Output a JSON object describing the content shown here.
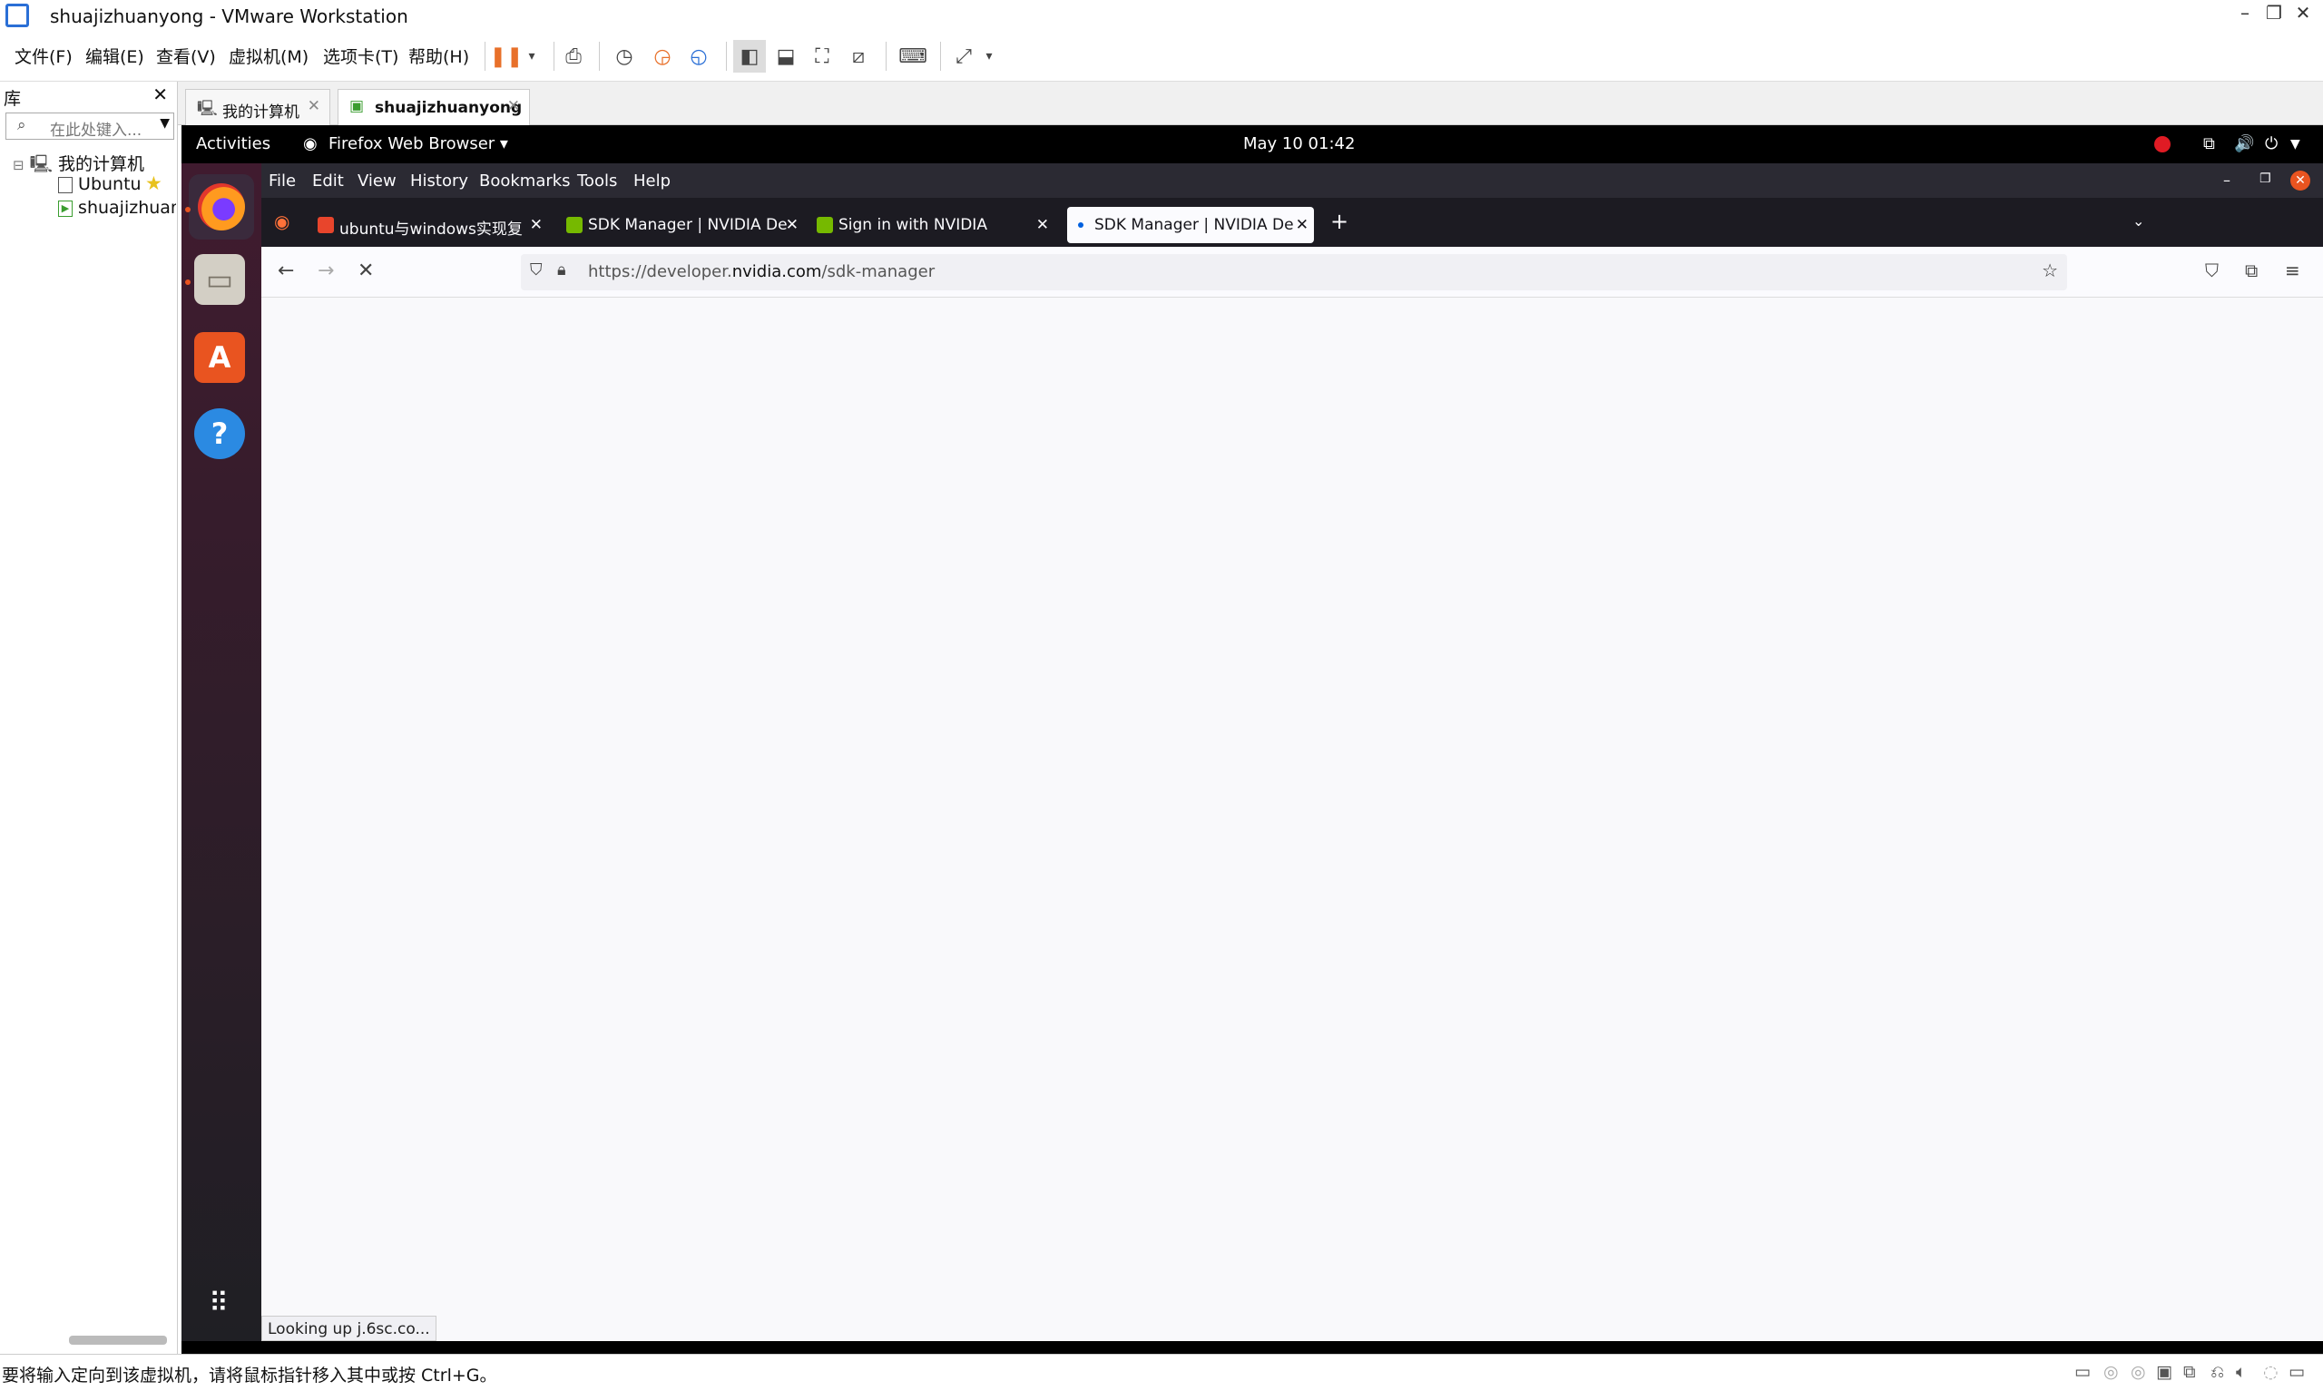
{
  "window": {
    "title": "shuajizhuanyong - VMware Workstation",
    "minimize": "–",
    "restore": "❐",
    "close": "✕"
  },
  "menubar": {
    "items": [
      "文件(F)",
      "编辑(E)",
      "查看(V)",
      "虚拟机(M)",
      "选项卡(T)",
      "帮助(H)"
    ]
  },
  "library": {
    "header": "库",
    "close": "✕",
    "search_placeholder": "在此处键入...",
    "tree": {
      "root": "我的计算机",
      "expander": "⊟",
      "children": [
        "Ubuntu",
        "shuajizhuanyong"
      ]
    }
  },
  "vm_tabs": [
    {
      "label": "我的计算机",
      "close": "✕"
    },
    {
      "label": "shuajizhuanyong",
      "close": "✕"
    }
  ],
  "gnome": {
    "activities": "Activities",
    "app": "Firefox Web Browser ▾",
    "clock": "May 10  01:42"
  },
  "firefox": {
    "menu": [
      "File",
      "Edit",
      "View",
      "History",
      "Bookmarks",
      "Tools",
      "Help"
    ],
    "tabs": [
      {
        "title": "ubuntu与windows实现复",
        "close": "✕",
        "color": "#e8452c"
      },
      {
        "title": "SDK Manager | NVIDIA De",
        "close": "✕",
        "color": "#76b900"
      },
      {
        "title": "Sign in with NVIDIA",
        "close": "✕",
        "color": "#76b900"
      },
      {
        "title": "SDK Manager | NVIDIA De",
        "close": "✕",
        "color": "#0060df"
      }
    ],
    "new_tab": "+",
    "url": {
      "prefix": "https://developer.",
      "domain": "nvidia.com",
      "path": "/sdk-manager"
    },
    "status": "Looking up j.6sc.co..."
  },
  "vm_status": {
    "message": "要将输入定向到该虚拟机，请将鼠标指针移入其中或按 Ctrl+G。"
  }
}
